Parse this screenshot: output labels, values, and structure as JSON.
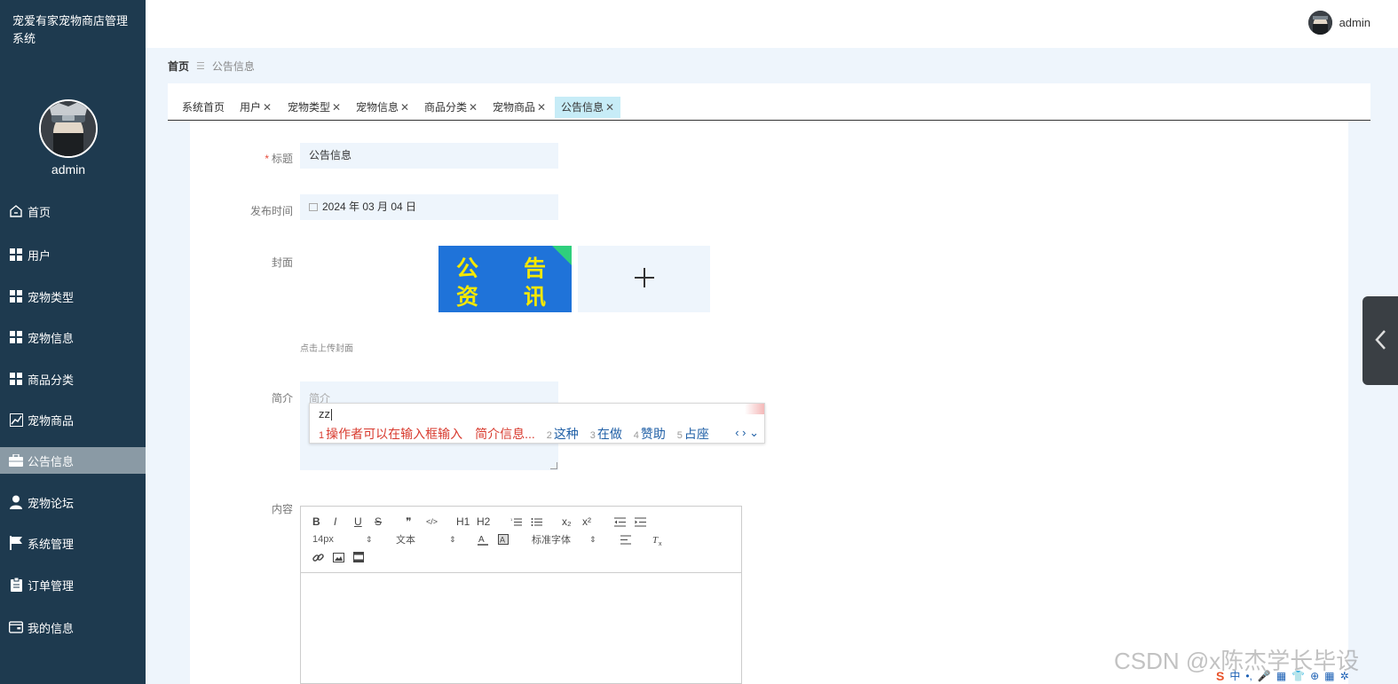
{
  "app": {
    "title": "宠爱有家宠物商店管理系统"
  },
  "sidebar": {
    "username": "admin",
    "items": [
      {
        "label": "首页",
        "icon": "home-icon",
        "active": false
      },
      {
        "label": "用户",
        "icon": "grid-icon",
        "active": false
      },
      {
        "label": "宠物类型",
        "icon": "grid-icon",
        "active": false
      },
      {
        "label": "宠物信息",
        "icon": "grid-icon",
        "active": false
      },
      {
        "label": "商品分类",
        "icon": "grid-icon",
        "active": false
      },
      {
        "label": "宠物商品",
        "icon": "chart-icon",
        "active": false
      },
      {
        "label": "公告信息",
        "icon": "briefcase-icon",
        "active": true
      },
      {
        "label": "宠物论坛",
        "icon": "user-icon",
        "active": false
      },
      {
        "label": "系统管理",
        "icon": "flag-icon",
        "active": false
      },
      {
        "label": "订单管理",
        "icon": "clipboard-icon",
        "active": false
      },
      {
        "label": "我的信息",
        "icon": "wallet-icon",
        "active": false
      }
    ]
  },
  "header": {
    "username": "admin"
  },
  "breadcrumb": {
    "home": "首页",
    "separator": "☰",
    "current": "公告信息"
  },
  "tabs": [
    {
      "label": "系统首页",
      "closable": false,
      "active": false
    },
    {
      "label": "用户",
      "closable": true,
      "active": false
    },
    {
      "label": "宠物类型",
      "closable": true,
      "active": false
    },
    {
      "label": "宠物信息",
      "closable": true,
      "active": false
    },
    {
      "label": "商品分类",
      "closable": true,
      "active": false
    },
    {
      "label": "宠物商品",
      "closable": true,
      "active": false
    },
    {
      "label": "公告信息",
      "closable": true,
      "active": true
    }
  ],
  "tab_close_glyph": "✕",
  "form": {
    "title": {
      "label": "标题",
      "required_mark": "*",
      "value": "公告信息"
    },
    "publish_time": {
      "label": "发布时间",
      "value": "2024 年 03 月 04 日"
    },
    "cover": {
      "label": "封面",
      "image_text": [
        "公",
        "告",
        "资",
        "讯"
      ],
      "upload_hint": "点击上传封面",
      "add_glyph": "+"
    },
    "intro": {
      "label": "简介",
      "placeholder": "简介"
    },
    "content": {
      "label": "内容"
    }
  },
  "ime": {
    "input": "zz",
    "candidates": [
      {
        "num": "1",
        "text": "操作者可以在输入框输入　简介信息..."
      },
      {
        "num": "2",
        "text": "这种"
      },
      {
        "num": "3",
        "text": "在做"
      },
      {
        "num": "4",
        "text": "赞助"
      },
      {
        "num": "5",
        "text": "占座"
      }
    ],
    "nav": "‹ › ⌄"
  },
  "editor": {
    "row1": [
      "B",
      "I",
      "U",
      "S",
      "❞",
      "</>",
      "H1",
      "H2",
      "ol",
      "ul",
      "x₂",
      "x²",
      "outdent",
      "indent"
    ],
    "size_select": "14px",
    "type_select": "文本",
    "font_select": "标准字体",
    "select_arrow": "⇕"
  },
  "watermark": "CSDN @x陈杰学长毕设",
  "tray": [
    "S",
    "中",
    "•,",
    "🎤",
    "▦",
    "👕",
    "⊕",
    "▦",
    "✲"
  ],
  "colors": {
    "sidebar_bg": "#1e3a4f",
    "sidebar_active": "#8a9aa5",
    "main_bg": "#eef5fc",
    "tab_active": "#c7ecf7",
    "required": "#e74c3c",
    "ime_first": "#d83a2e",
    "ime_other": "#1f5fa6",
    "cover_blue": "#1f73d9",
    "cover_text": "#f5e800",
    "cover_corner": "#2fcf7d"
  }
}
